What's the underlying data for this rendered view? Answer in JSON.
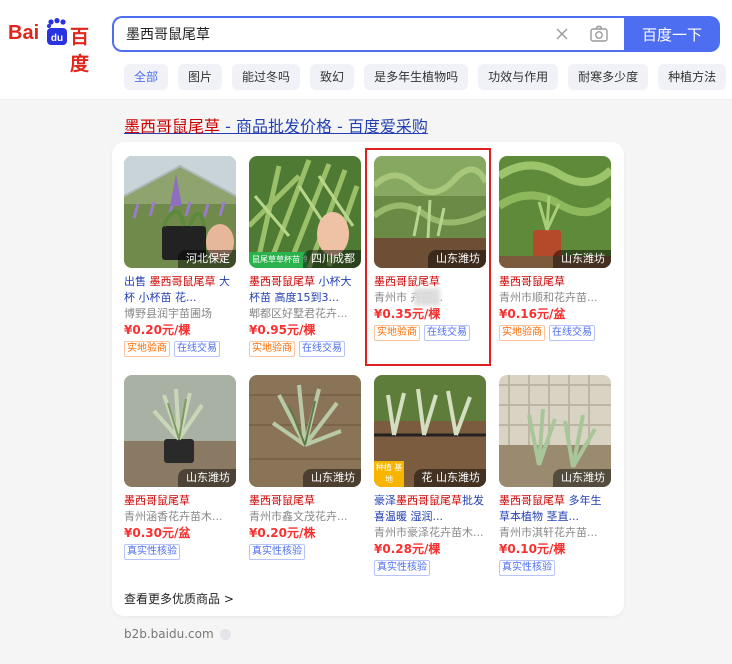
{
  "header": {
    "logo_bai": "Bai",
    "logo_du": "百度",
    "search": {
      "value": "墨西哥鼠尾草",
      "clear_glyph": "×"
    },
    "search_button": "百度一下"
  },
  "tabs": [
    {
      "label": "全部",
      "active": true
    },
    {
      "label": "图片"
    },
    {
      "label": "能过冬吗"
    },
    {
      "label": "致幻"
    },
    {
      "label": "是多年生植物吗"
    },
    {
      "label": "功效与作用"
    },
    {
      "label": "耐寒多少度"
    },
    {
      "label": "种植方法"
    }
  ],
  "result": {
    "title_highlight": "墨西哥鼠尾草",
    "title_rest": " - 商品批发价格 - 百度爱采购",
    "more_link": "查看更多优质商品 >",
    "source": "b2b.baidu.com"
  },
  "products": [
    {
      "location": "河北保定",
      "title_pre": "出售 ",
      "title_highlight": "墨西哥鼠尾草",
      "title_post": " 大杯 小杯苗 花...",
      "seller": "博野县润宇苗圃场",
      "price": "¥0.20元/棵",
      "tags": [
        "实地验商",
        "在线交易"
      ]
    },
    {
      "location": "四川成都",
      "badge": "鼠尾草草杯苗  免费",
      "title_pre": "",
      "title_highlight": "墨西哥鼠尾草",
      "title_post": " 小杯大杯苗 高度15到3...",
      "seller": "郫都区好墅君花卉...",
      "price": "¥0.95元/棵",
      "tags": [
        "实地验商",
        "在线交易"
      ]
    },
    {
      "location": "山东潍坊",
      "title_pre": "",
      "title_highlight": "墨西哥鼠尾草",
      "title_post": "",
      "seller": "青州市        卉苗...",
      "price": "¥0.35元/棵",
      "tags": [
        "实地验商",
        "在线交易"
      ]
    },
    {
      "location": "山东潍坊",
      "title_pre": "",
      "title_highlight": "墨西哥鼠尾草",
      "title_post": "",
      "seller": "青州市顺和花卉苗...",
      "price": "¥0.16元/盆",
      "tags": [
        "实地验商",
        "在线交易"
      ]
    },
    {
      "location": "山东潍坊",
      "title_pre": "",
      "title_highlight": "墨西哥鼠尾草",
      "title_post": "",
      "seller": "青州涵香花卉苗木...",
      "price": "¥0.30元/盆",
      "tags": [
        "真实性核验"
      ]
    },
    {
      "location": "山东潍坊",
      "title_pre": "",
      "title_highlight": "墨西哥鼠尾草",
      "title_post": "",
      "seller": "青州市鑫文茂花卉...",
      "price": "¥0.20元/株",
      "tags": [
        "真实性核验"
      ]
    },
    {
      "location": "山东潍坊",
      "badge2": "种植 基地",
      "badge2_extra": "花",
      "title_pre": "豪泽",
      "title_highlight": "墨西哥鼠尾草",
      "title_post": "批发 喜温暖 湿润...",
      "seller": "青州市豪泽花卉苗木...",
      "price": "¥0.28元/棵",
      "tags": [
        "真实性核验"
      ]
    },
    {
      "location": "山东潍坊",
      "title_pre": "",
      "title_highlight": "墨西哥鼠尾草",
      "title_post": " 多年生草本植物 茎直...",
      "seller": "青州市淇轩花卉苗...",
      "price": "¥0.10元/棵",
      "tags": [
        "真实性核验"
      ]
    }
  ],
  "colors": {
    "accent": "#4e6ef2",
    "highlight": "#cc0000",
    "price": "#f73131",
    "link": "#2440b3"
  }
}
